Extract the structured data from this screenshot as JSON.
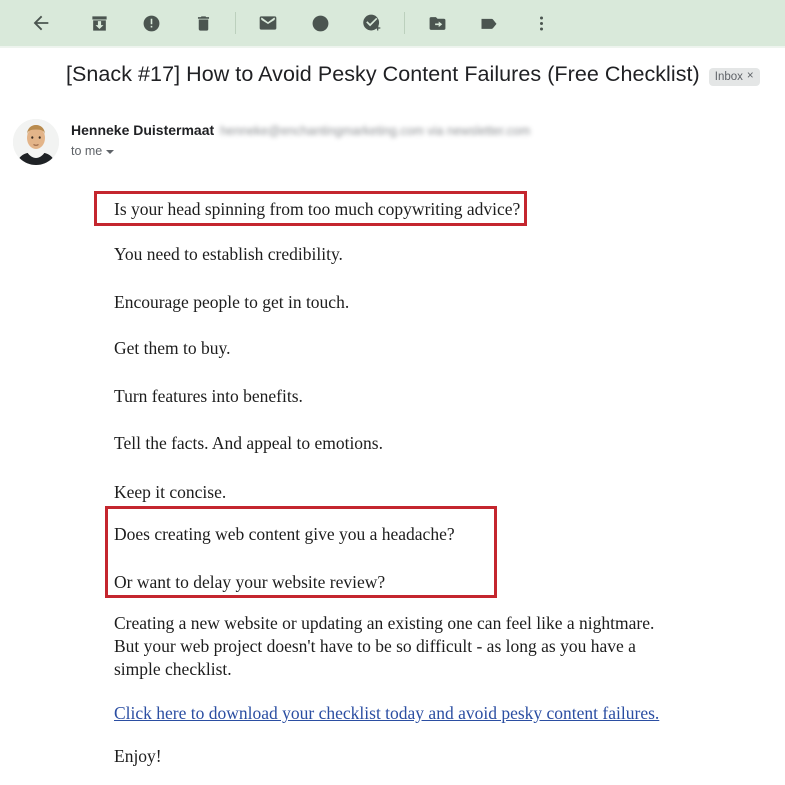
{
  "toolbar": {
    "back_label": "Back",
    "icons": [
      {
        "name": "back-arrow-icon",
        "label": "Back"
      },
      {
        "name": "archive-icon",
        "label": "Archive"
      },
      {
        "name": "report-spam-icon",
        "label": "Report spam"
      },
      {
        "name": "delete-icon",
        "label": "Delete"
      },
      {
        "name": "mark-unread-icon",
        "label": "Mark as unread"
      },
      {
        "name": "snooze-clock-icon",
        "label": "Snooze"
      },
      {
        "name": "add-to-tasks-icon",
        "label": "Add to Tasks"
      },
      {
        "name": "move-to-icon",
        "label": "Move to"
      },
      {
        "name": "labels-tag-icon",
        "label": "Labels"
      },
      {
        "name": "more-options-icon",
        "label": "More"
      }
    ]
  },
  "subject": {
    "title": "[Snack #17] How to Avoid Pesky Content Failures (Free Checklist)",
    "chip_label": "Inbox",
    "chip_close": "×"
  },
  "sender": {
    "name": "Henneke Duistermaat",
    "email": "henneke@enchantingmarketing.com via newsletter.com",
    "recipient": "to me",
    "avatar_name": "sender-avatar-photo"
  },
  "body": {
    "highlight_1": "Is your head spinning from too much copywriting advice?",
    "lines": [
      "You need to establish credibility.",
      "Encourage people to get in touch.",
      "Get them to buy.",
      "Turn features into benefits.",
      "Tell the facts. And appeal to emotions.",
      "Keep it concise."
    ],
    "highlight_2a": "Does creating web content give you a headache?",
    "highlight_2b": "Or want to delay your website review?",
    "closing_paragraph": "Creating a new website or updating an existing one can feel like a nightmare. But your web project doesn't have to be so difficult - as long as you have a simple checklist.",
    "link_text": "Click here to download your checklist today and avoid pesky content failures.",
    "signoff": "Enjoy!"
  },
  "colors": {
    "toolbar_background": "#d9e9da",
    "highlight_border": "#c4262e",
    "link": "#2b4ea2",
    "icon": "#4b5550",
    "chip_background": "#e4e6e6"
  }
}
